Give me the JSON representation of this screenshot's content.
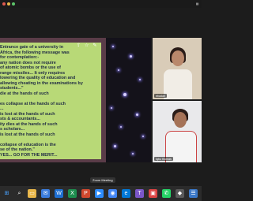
{
  "meeting": {
    "slide_lines": [
      "Entrance gate of a university in",
      "Africa, the following message was",
      "for contemplation:-",
      "any nation does not require",
      "of atomic bombs or the use of",
      "range missiles... It only requires",
      "lowering the quality of education and",
      "allowing cheating in the examinations by",
      "students...\"",
      "die at the hands of such",
      "",
      "es collapse at the hands of such",
      "...",
      "is lost at the hands of such",
      "sts & accountants...",
      "ity dies at the hands of such",
      "s scholars...",
      "is lost at the hands of such",
      "",
      "collapse of education is the",
      "se of the nation.\"",
      "YES... GO FOR THE MERIT..."
    ],
    "participants": [
      {
        "name": "ebadah"
      },
      {
        "name": "Iqbu thomas"
      }
    ],
    "tooltip": "Zoom Meeting"
  }
}
